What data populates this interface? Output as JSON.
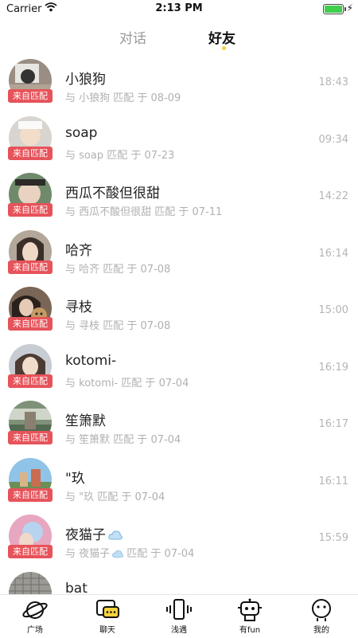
{
  "status_bar": {
    "carrier": "Carrier",
    "time": "2:13 PM"
  },
  "tabs": {
    "dialog": "对话",
    "friends": "好友"
  },
  "badge_text": "来自匹配",
  "friends": [
    {
      "name": "小狼狗",
      "subtitle": "与 小狼狗 匹配 于 08-09",
      "time": "18:43"
    },
    {
      "name": "soap",
      "subtitle": "与 soap 匹配 于 07-23",
      "time": "09:34"
    },
    {
      "name": "西瓜不酸但很甜",
      "subtitle": "与 西瓜不酸但很甜 匹配 于 07-11",
      "time": "14:22"
    },
    {
      "name": "哈齐",
      "subtitle": "与 哈齐 匹配 于 07-08",
      "time": "16:14"
    },
    {
      "name": "寻枝",
      "subtitle": "与 寻枝 匹配 于 07-08",
      "time": "15:00"
    },
    {
      "name": "kotomi-",
      "subtitle": "与 kotomi- 匹配 于 07-04",
      "time": "16:19"
    },
    {
      "name": "笙箫默",
      "subtitle": "与 笙箫默 匹配 于 07-04",
      "time": "16:17"
    },
    {
      "name": "\"玖",
      "subtitle": "与 \"玖 匹配 于 07-04",
      "time": "16:11"
    },
    {
      "name": "夜猫子",
      "subtitle": "与 夜猫子",
      "subtitle_suffix": "匹配 于 07-04",
      "time": "15:59"
    },
    {
      "name": "bat",
      "subtitle": "",
      "time": ""
    }
  ],
  "bottom_nav": [
    {
      "label": "广场",
      "icon": "planet-icon"
    },
    {
      "label": "聊天",
      "icon": "chat-icon"
    },
    {
      "label": "浅遇",
      "icon": "phone-vibrate-icon"
    },
    {
      "label": "有fun",
      "icon": "robot-icon"
    },
    {
      "label": "我的",
      "icon": "profile-face-icon"
    }
  ],
  "colors": {
    "badge": "#e6535a",
    "accent_dot": "#f7d23e",
    "battery": "#3fcf4d"
  }
}
